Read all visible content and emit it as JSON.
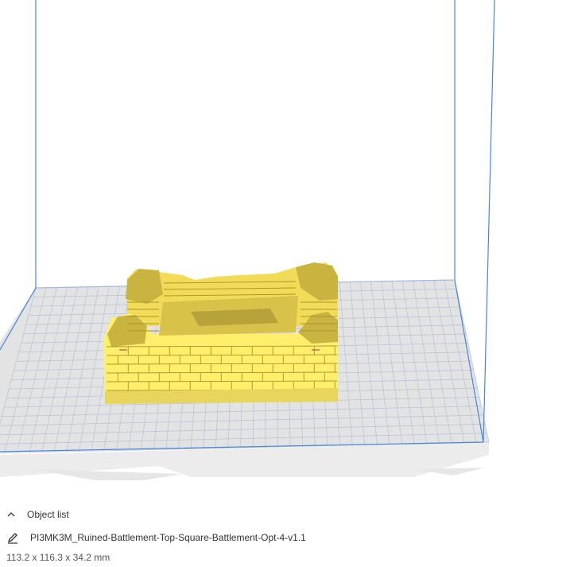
{
  "viewport": {
    "model_color": "#ffef6b",
    "build_volume_color": "#4a86d4",
    "build_plate_color": "#e3e3e3",
    "grid_color": "#b9c6d8"
  },
  "object_panel": {
    "toggle_label": "Object list",
    "toggle_icon": "chevron-up-icon",
    "edit_icon": "pencil-icon",
    "object_name": "PI3MK3M_Ruined-Battlement-Top-Square-Battlement-Opt-4-v1.1",
    "dimensions": "113.2 x 116.3 x 34.2 mm"
  }
}
